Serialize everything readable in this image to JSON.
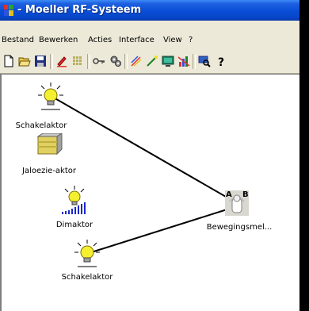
{
  "window": {
    "title": "- Moeller RF-Systeem"
  },
  "menu": [
    {
      "id": "bestand",
      "label": "Bestand"
    },
    {
      "id": "bewerken",
      "label": "Bewerken"
    },
    {
      "id": "acties",
      "label": "Acties"
    },
    {
      "id": "interface",
      "label": "Interface"
    },
    {
      "id": "view",
      "label": "View"
    },
    {
      "id": "help",
      "label": "?"
    }
  ],
  "toolbar": {
    "icons": [
      "new-file-icon",
      "open-folder-icon",
      "save-icon",
      "edit-pencil-icon",
      "grid-icon",
      "key-icon",
      "gears-icon",
      "sparkle-icon",
      "wand-icon",
      "monitor-icon",
      "chart-icon",
      "search-icon",
      "help-icon"
    ]
  },
  "devices": {
    "schakelaktor1": {
      "label": "Schakelaktor",
      "icon": "bulb-icon"
    },
    "jaloezie": {
      "label": "Jaloezie-aktor",
      "icon": "blind-icon"
    },
    "dimaktor": {
      "label": "Dimaktor",
      "icon": "dimmer-bulb-icon"
    },
    "schakelaktor2": {
      "label": "Schakelaktor",
      "icon": "bulb-icon"
    },
    "bewegingsmelder": {
      "label": "Bewegingsmel...",
      "icon": "motion-sensor-icon",
      "badge_a": "A",
      "badge_b": "B"
    }
  },
  "colors": {
    "canvas": "#ffffff",
    "link": "#000000",
    "titlebar": "#0a4fd8"
  }
}
